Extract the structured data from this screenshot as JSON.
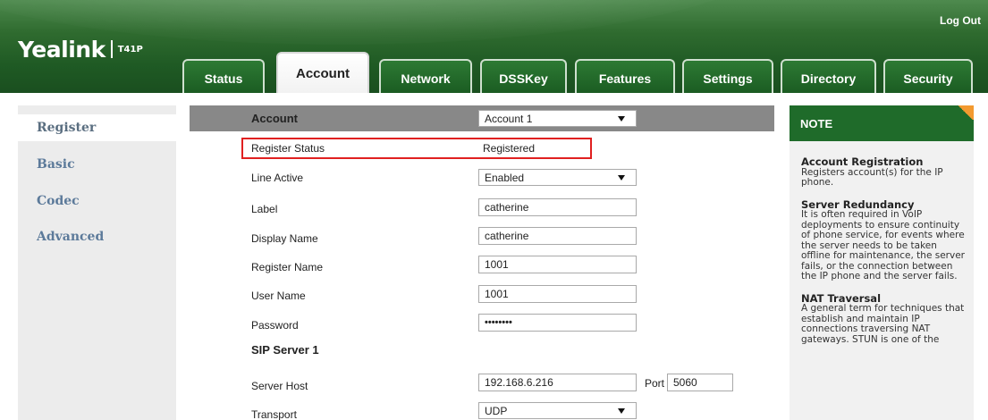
{
  "header": {
    "logo_word": "Yealink",
    "logo_model": "T41P",
    "logout": "Log Out",
    "tabs": [
      "Status",
      "Account",
      "Network",
      "DSSKey",
      "Features",
      "Settings",
      "Directory",
      "Security"
    ],
    "active_tab": "Account"
  },
  "sidebar": {
    "items": [
      "Register",
      "Basic",
      "Codec",
      "Advanced"
    ],
    "active": "Register"
  },
  "form": {
    "account_label": "Account",
    "account_value": "Account 1",
    "register_status_label": "Register Status",
    "register_status_value": "Registered",
    "line_active_label": "Line Active",
    "line_active_value": "Enabled",
    "label_label": "Label",
    "label_value": "catherine",
    "display_name_label": "Display Name",
    "display_name_value": "catherine",
    "register_name_label": "Register Name",
    "register_name_value": "1001",
    "user_name_label": "User Name",
    "user_name_value": "1001",
    "password_label": "Password",
    "password_value": "••••••••",
    "sip_server_heading": "SIP Server 1",
    "server_host_label": "Server Host",
    "server_host_value": "192.168.6.216",
    "port_label": "Port",
    "port_value": "5060",
    "transport_label": "Transport",
    "transport_value": "UDP"
  },
  "note": {
    "heading": "NOTE",
    "sections": [
      {
        "title": "Account Registration",
        "text": "Registers account(s) for the IP phone."
      },
      {
        "title": "Server Redundancy",
        "text": "It is often required in VoIP deployments to ensure continuity of phone service, for events where the server needs to be taken offline for maintenance, the server fails, or the connection between the IP phone and the server fails."
      },
      {
        "title": "NAT Traversal",
        "text": "A general term for techniques that establish and maintain IP connections traversing NAT gateways. STUN is one of the"
      }
    ]
  },
  "colors": {
    "header_green": "#1f5a24",
    "note_green": "#1f6b2a",
    "nav_text": "#5c7a9a",
    "highlight_red": "#e02020",
    "note_corner_orange": "#f39a30"
  },
  "icons": [
    "dropdown-arrow-icon"
  ]
}
